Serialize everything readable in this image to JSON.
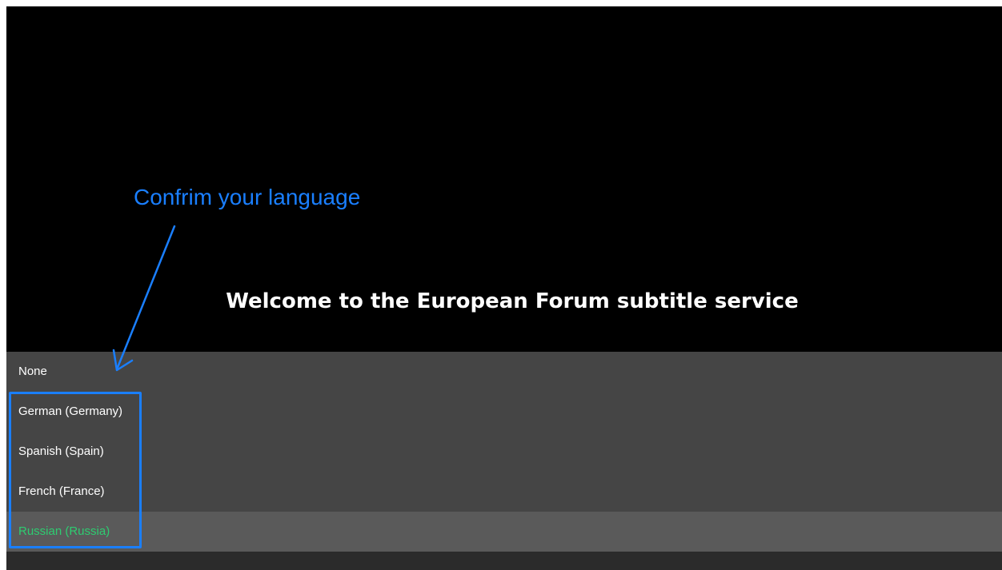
{
  "welcome": {
    "title": "Welcome to the European Forum subtitle service"
  },
  "language_menu": {
    "items": [
      {
        "label": "None"
      },
      {
        "label": "German (Germany)"
      },
      {
        "label": "Spanish (Spain)"
      },
      {
        "label": "French (France)"
      },
      {
        "label": "Russian (Russia)"
      }
    ],
    "selected_index": 4
  },
  "annotation": {
    "text": "Confrim your language",
    "color": "#1a7fff"
  },
  "colors": {
    "selected_text": "#2ecc71",
    "menu_background": "#454545",
    "selected_background": "#5a5a5a"
  }
}
